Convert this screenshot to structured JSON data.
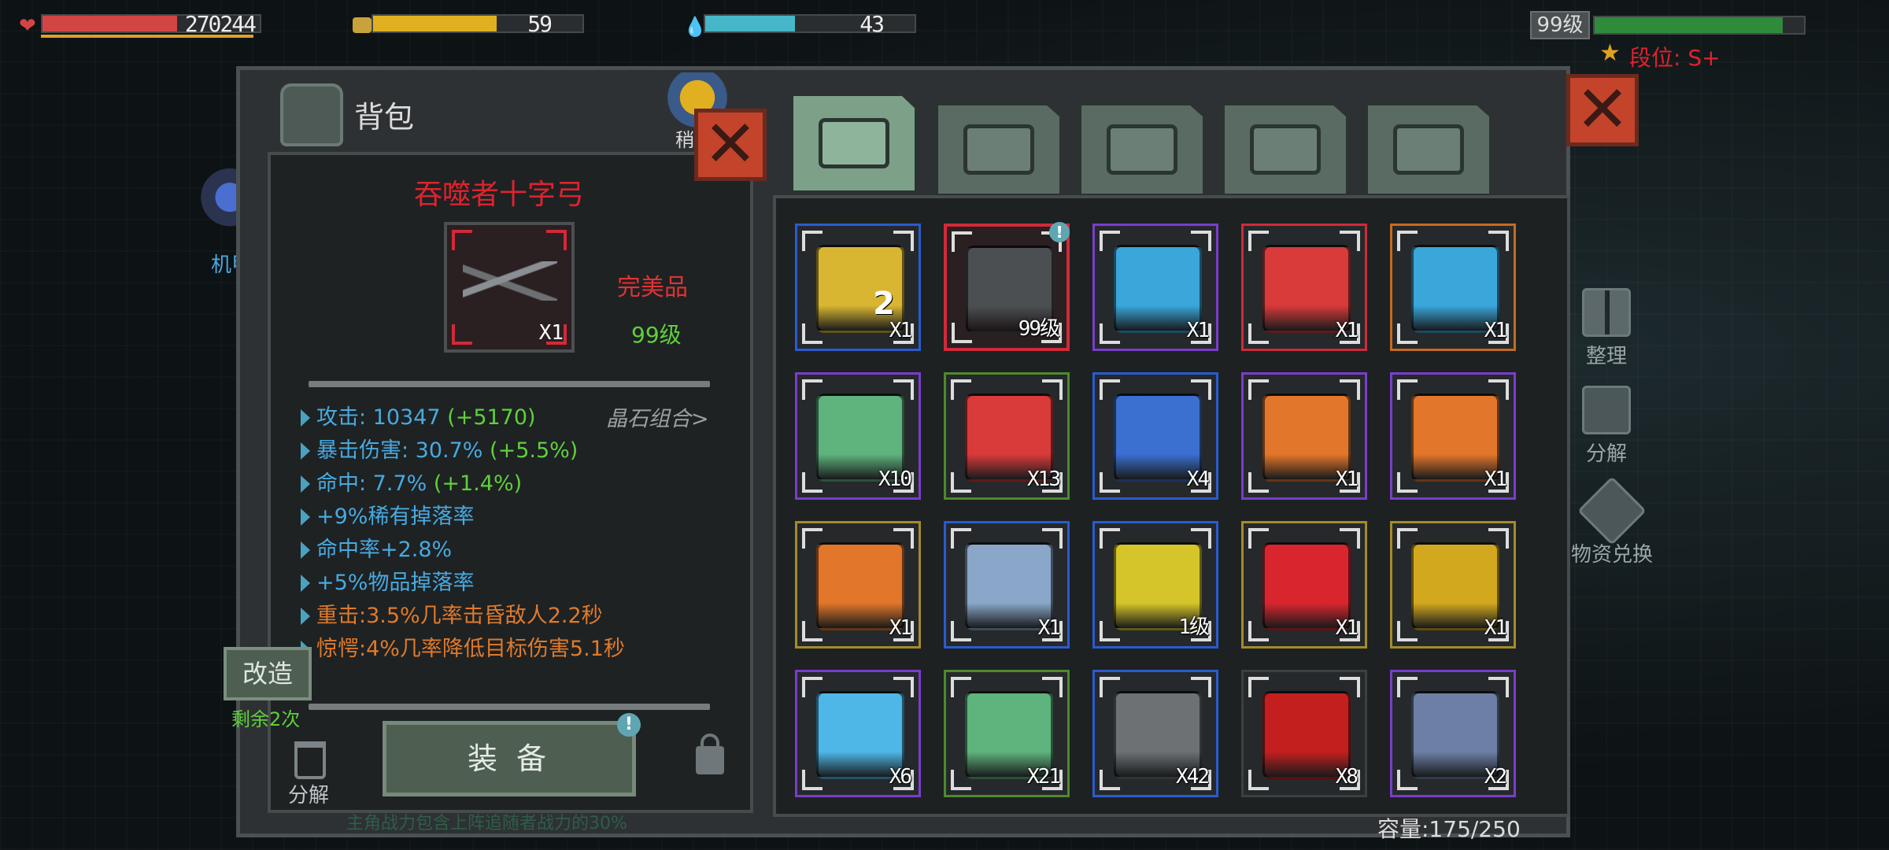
{
  "hud": {
    "hp_value": "270244",
    "hp_fraction": 0.62,
    "hunger_value": "59",
    "hunger_fraction": 0.59,
    "water_value": "43",
    "water_fraction": 0.43,
    "level_label": "99级",
    "level_fraction": 0.9,
    "rank_label": "段位: S+"
  },
  "left_side": {
    "mech_label": "机甲",
    "helper_label": "稍"
  },
  "backpack": {
    "title": "背包",
    "capacity": "容量:175/250",
    "tabs": [
      {
        "name": "backpack",
        "active": true
      },
      {
        "name": "medical",
        "active": false
      },
      {
        "name": "armor",
        "active": false
      },
      {
        "name": "weapon",
        "active": false
      },
      {
        "name": "tool",
        "active": false
      }
    ]
  },
  "item_detail": {
    "name": "吞噬者十字弓",
    "qty": "X1",
    "quality": "完美品",
    "level": "99级",
    "crystal_link": "晶石组合>",
    "stats": [
      {
        "label": "攻击: 10347 ",
        "bonus": "(+5170)",
        "color": "#49a9e0"
      },
      {
        "label": "暴击伤害: 30.7% ",
        "bonus": "(+5.5%)",
        "color": "#49a9e0"
      },
      {
        "label": "命中: 7.7% ",
        "bonus": "(+1.4%)",
        "color": "#49a9e0"
      },
      {
        "label": "+9%稀有掉落率",
        "bonus": "",
        "color": "#49a9e0"
      },
      {
        "label": "命中率+2.8%",
        "bonus": "",
        "color": "#49a9e0"
      },
      {
        "label": "+5%物品掉落率",
        "bonus": "",
        "color": "#49a9e0"
      },
      {
        "label": "重击:3.5%几率击昏敌人2.2秒",
        "bonus": "",
        "color": "#e07a2a"
      },
      {
        "label": "惊愕:4%几率降低目标伤害5.1秒",
        "bonus": "",
        "color": "#e07a2a"
      }
    ],
    "footer_note": "主角战力包含上阵追随者战力的30%",
    "modify_button": "改造",
    "modify_remaining": "剩余2次",
    "dismantle_label": "分解",
    "equip_button": "装 备"
  },
  "side_buttons": {
    "sort": "整理",
    "dismantle": "分解",
    "exchange": "物资兑换"
  },
  "inventory": [
    {
      "name": "exp-card",
      "qty": "X1",
      "rarity": "blue",
      "art": "#d9b632",
      "extra": "2"
    },
    {
      "name": "devourer-crossbow",
      "qty": "99级",
      "rarity": "red",
      "art": "#4b4f52",
      "badge": true
    },
    {
      "name": "blue-shield-box",
      "qty": "X1",
      "rarity": "purple",
      "art": "#3aa6d9"
    },
    {
      "name": "red-weapon-box",
      "qty": "X1",
      "rarity": "red",
      "art": "#d93a3a"
    },
    {
      "name": "blue-shield-box-2",
      "qty": "X1",
      "rarity": "orange",
      "art": "#3aa6d9"
    },
    {
      "name": "green-heart-box",
      "qty": "X10",
      "rarity": "purple",
      "art": "#5fb37d"
    },
    {
      "name": "red-weapon-box-2",
      "qty": "X13",
      "rarity": "green",
      "art": "#d93a3a"
    },
    {
      "name": "blue-container",
      "qty": "X4",
      "rarity": "blue",
      "art": "#3b6fd0"
    },
    {
      "name": "upgrade-chip",
      "qty": "X1",
      "rarity": "purple",
      "art": "#e2762a"
    },
    {
      "name": "upgrade-chip-2",
      "qty": "X1",
      "rarity": "purple",
      "art": "#e2762a"
    },
    {
      "name": "upgrade-chip-3",
      "qty": "X1",
      "rarity": "gold",
      "art": "#e2762a"
    },
    {
      "name": "map",
      "qty": "X1",
      "rarity": "blue",
      "art": "#8aa6c8"
    },
    {
      "name": "gold-core",
      "qty": "1级",
      "rarity": "blue",
      "art": "#d6c52a"
    },
    {
      "name": "red-gem",
      "qty": "X1",
      "rarity": "gold",
      "art": "#d9262e"
    },
    {
      "name": "gold-crate",
      "qty": "X1",
      "rarity": "gold",
      "art": "#d2a81e"
    },
    {
      "name": "tool-manual",
      "qty": "X6",
      "rarity": "purple",
      "art": "#4fb6e8"
    },
    {
      "name": "green-heart-box-2",
      "qty": "X21",
      "rarity": "green",
      "art": "#5fb37d"
    },
    {
      "name": "chip",
      "qty": "X42",
      "rarity": "blue",
      "art": "#6d7174"
    },
    {
      "name": "apples",
      "qty": "X8",
      "rarity": "none",
      "art": "#c41f1f"
    },
    {
      "name": "wrench-tool",
      "qty": "X2",
      "rarity": "purple",
      "art": "#6d7fa6"
    }
  ],
  "colors": {
    "hp": "#d24545",
    "hunger": "#e0b020",
    "water": "#45b7c9",
    "level": "#2f8a3a",
    "title_red": "#e0222e",
    "quality_red": "#e23232",
    "level_green": "#5fd03a",
    "bonus_green": "#5fd03a"
  }
}
